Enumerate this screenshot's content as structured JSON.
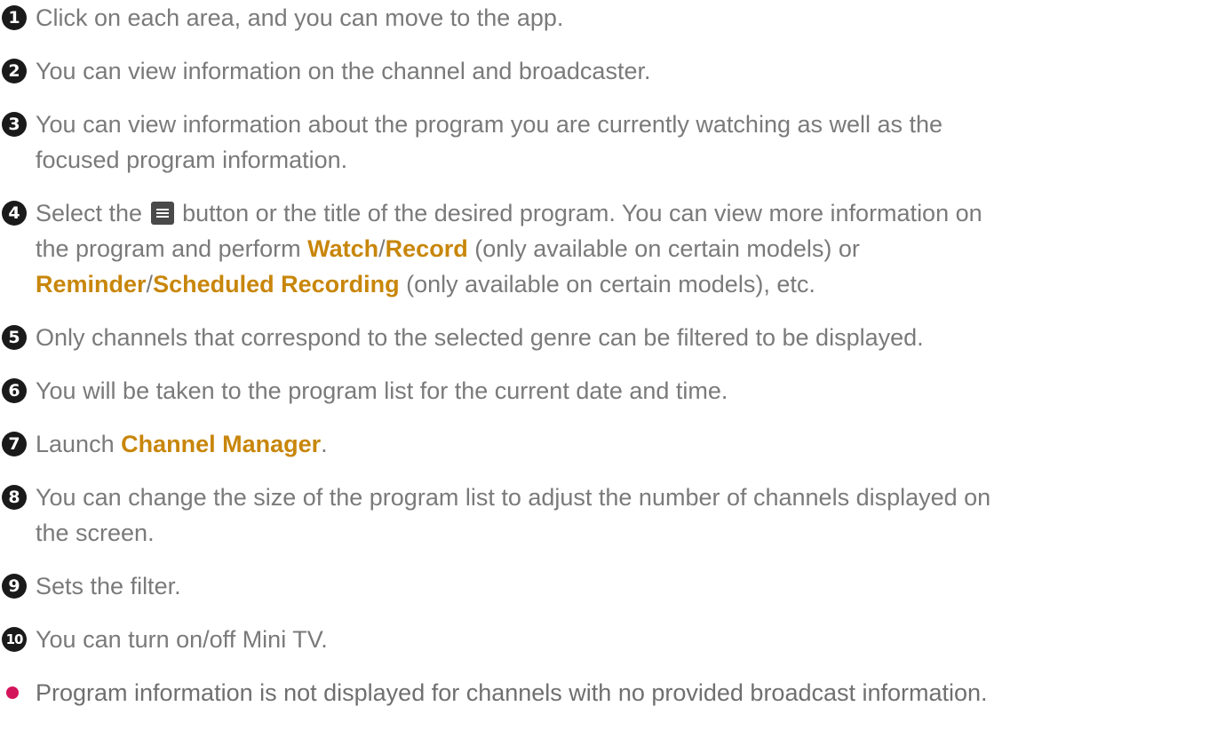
{
  "items": [
    {
      "num": "1",
      "text": "Click on each area, and you can move to the app."
    },
    {
      "num": "2",
      "text": "You can view information on the channel and broadcaster."
    },
    {
      "num": "3",
      "line1": "You can view information about the program you are currently watching as well as the",
      "line2": "focused program information."
    },
    {
      "num": "4",
      "line1_a": "Select the",
      "icon": "menu-icon",
      "line1_b": "button or the title of the desired program. You can view more information on",
      "line2_a": "the program and perform ",
      "watch": "Watch",
      "slash1": "/",
      "record": "Record",
      "line2_b": " (only available on certain models) or",
      "reminder": "Reminder",
      "slash2": "/",
      "scheduled": "Scheduled Recording",
      "line3_b": " (only available on certain models), etc."
    },
    {
      "num": "5",
      "text": "Only channels that correspond to the selected genre can be filtered to be displayed."
    },
    {
      "num": "6",
      "text": "You will be taken to the program list for the current date and time."
    },
    {
      "num": "7",
      "text_a": "Launch ",
      "highlight": "Channel Manager",
      "text_b": "."
    },
    {
      "num": "8",
      "line1": "You can change the size of the program list to adjust the number of channels displayed on",
      "line2": "the screen."
    },
    {
      "num": "9",
      "text": "Sets the filter."
    },
    {
      "num": "10",
      "text": "You can turn on/off Mini TV."
    }
  ],
  "note": {
    "text": "Program information is not displayed for channels with no provided broadcast information.",
    "bullet_color": "#d4145a"
  },
  "colors": {
    "text": "#7a7a7a",
    "highlight": "#c8860a",
    "badge": "#1a1a1a"
  }
}
